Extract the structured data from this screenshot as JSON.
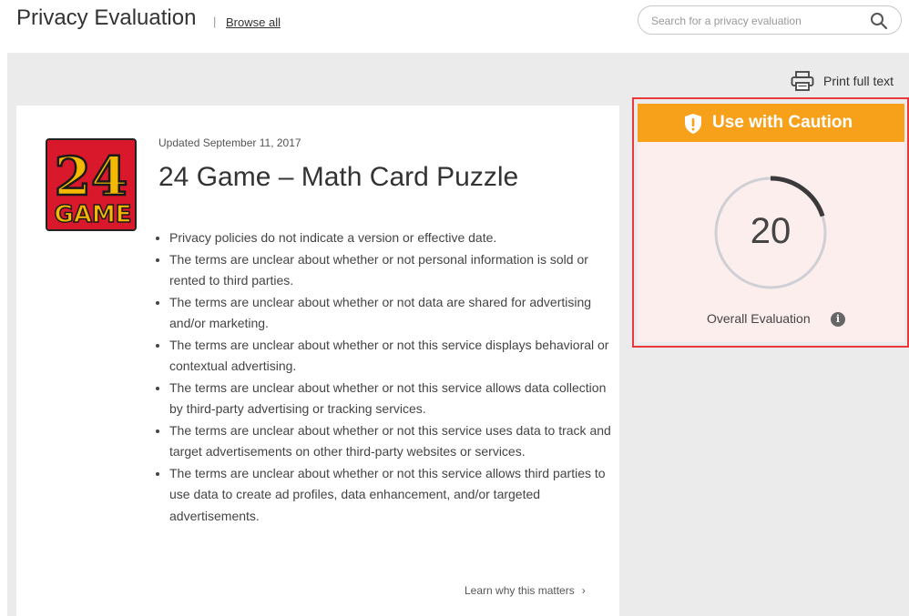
{
  "header": {
    "title": "Privacy Evaluation",
    "separator": "|",
    "browse_label": "Browse all",
    "search": {
      "placeholder": "Search for a privacy evaluation",
      "value": ""
    }
  },
  "toolbar": {
    "print_label": "Print full text"
  },
  "product": {
    "updated": "Updated September 11, 2017",
    "title": "24 Game – Math Card Puzzle",
    "logo_text_top": "24",
    "logo_text_bottom": "GAME",
    "findings": [
      "Privacy policies do not indicate a version or effective date.",
      "The terms are unclear about whether or not personal information is sold or rented to third parties.",
      "The terms are unclear about whether or not data are shared for advertising and/or marketing.",
      "The terms are unclear about whether or not this service displays behavioral or contextual advertising.",
      "The terms are unclear about whether or not this service allows data collection by third-party advertising or tracking services.",
      "The terms are unclear about whether or not this service uses data to track and target advertisements on other third-party websites or services.",
      "The terms are unclear about whether or not this service allows third parties to use data to create ad profiles, data enhancement, and/or targeted advertisements."
    ],
    "learn_more": "Learn why this matters"
  },
  "evaluation": {
    "rating_label": "Use with Caution",
    "score": "20",
    "score_fraction": 0.2,
    "overall_label": "Overall Evaluation",
    "info_glyph": "i",
    "colors": {
      "header": "#f7a11a",
      "background": "#fdeeee",
      "highlight_border": "#e83a3a",
      "gauge_track": "#cfcfd6",
      "gauge_fill": "#3a3a3a"
    }
  },
  "icons": {
    "search": "search-icon",
    "print": "printer-icon",
    "shield": "shield-exclamation-icon",
    "info": "info-icon",
    "chevron": "chevron-right-icon"
  }
}
